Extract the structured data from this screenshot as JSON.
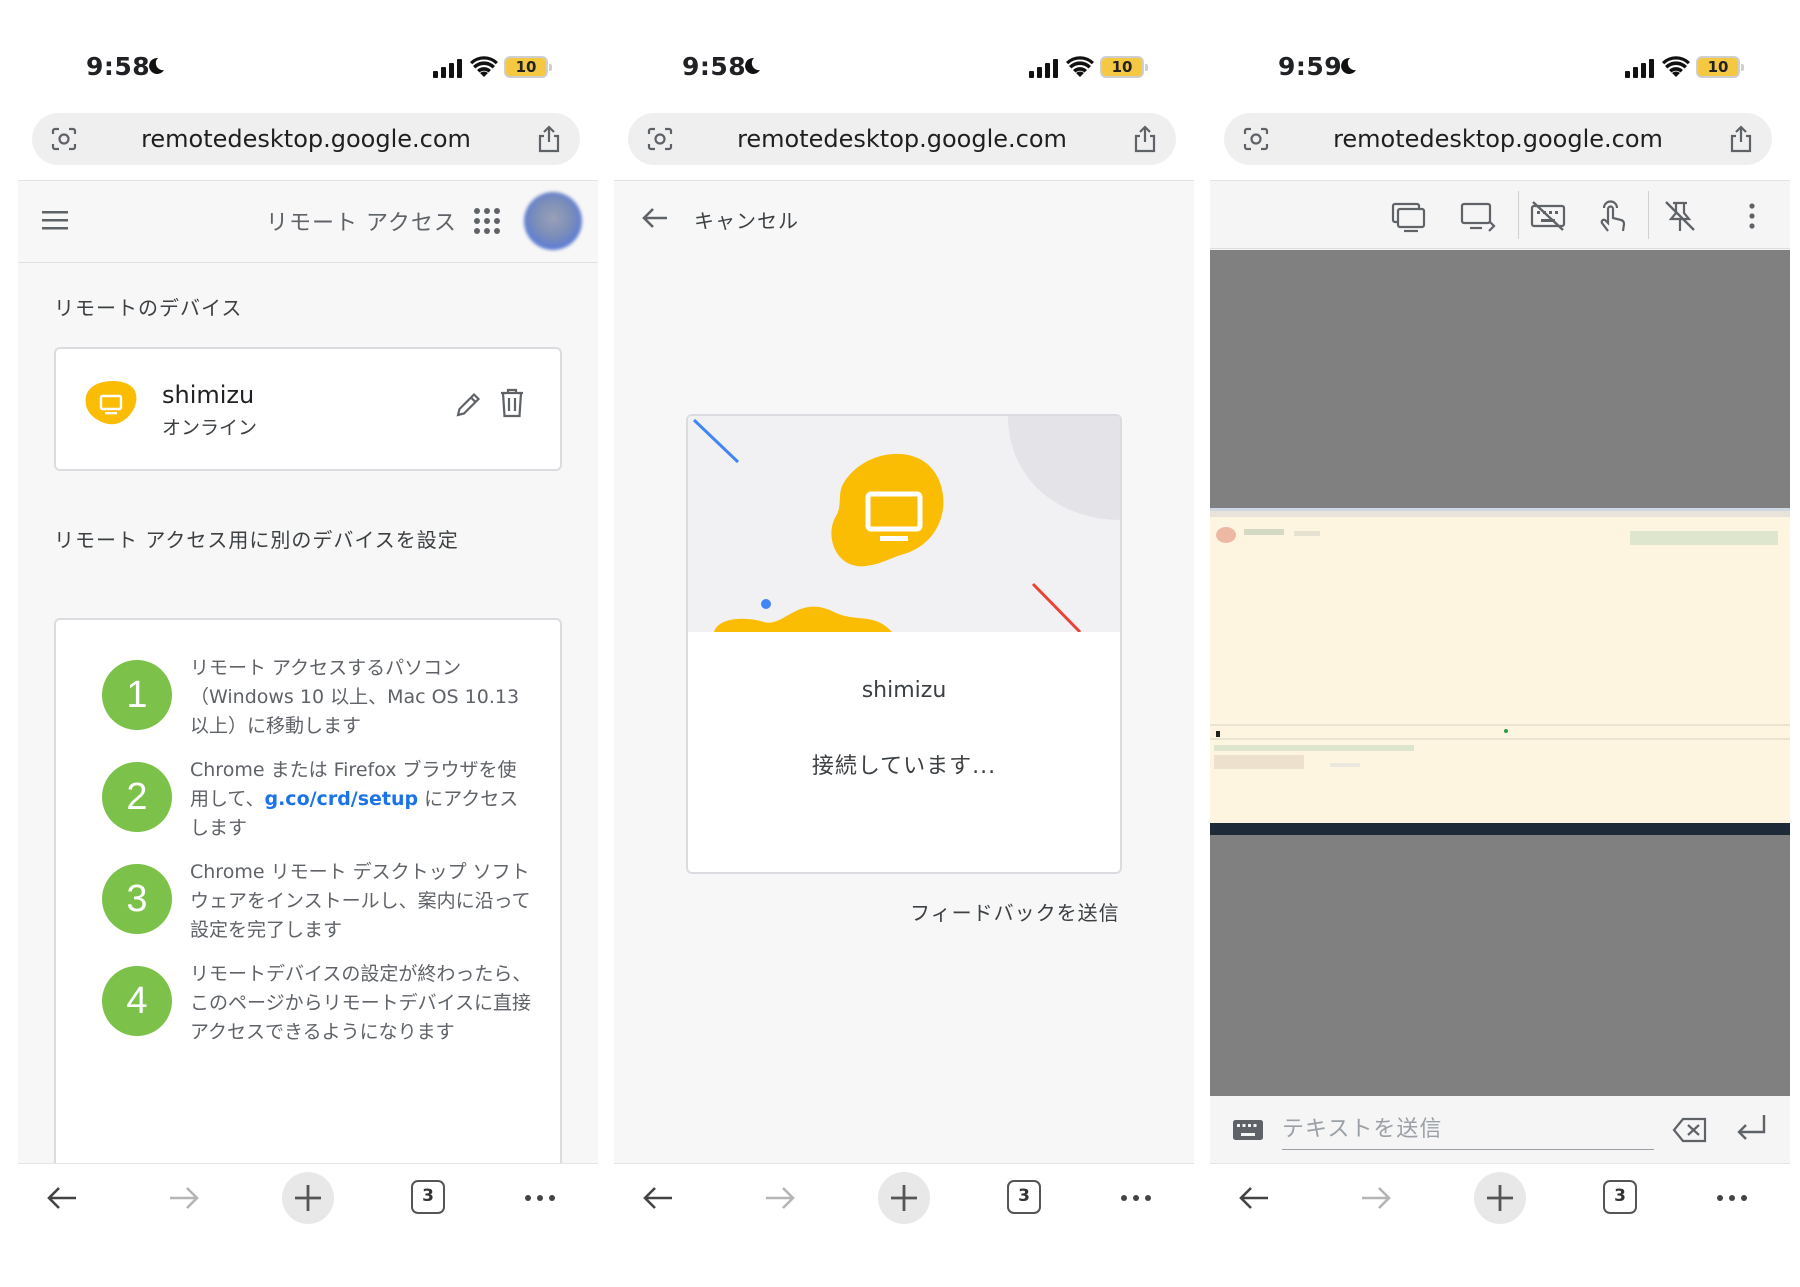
{
  "phones": [
    {
      "status": {
        "time": "9:58",
        "battery": "10"
      },
      "url": "remotedesktop.google.com",
      "tab_count": "3",
      "app_title": "リモート アクセス",
      "remote_devices_title": "リモートのデバイス",
      "device": {
        "name": "shimizu",
        "status": "オンライン"
      },
      "setup_title": "リモート アクセス用に別のデバイスを設定",
      "steps": [
        {
          "num": "1",
          "text": "リモート アクセスするパソコン（Windows 10 以上、Mac OS 10.13 以上）に移動します"
        },
        {
          "num": "2",
          "text_before": "Chrome または Firefox ブラウザを使用して、",
          "link": "g.co/crd/setup",
          "text_after": " にアクセスします"
        },
        {
          "num": "3",
          "text": "Chrome リモート デスクトップ ソフトウェアをインストールし、案内に沿って設定を完了します"
        },
        {
          "num": "4",
          "text": "リモートデバイスの設定が終わったら、このページからリモートデバイスに直接アクセスできるようになります"
        }
      ]
    },
    {
      "status": {
        "time": "9:58",
        "battery": "10"
      },
      "url": "remotedesktop.google.com",
      "tab_count": "3",
      "cancel_label": "キャンセル",
      "device_name": "shimizu",
      "connecting_text": "接続しています...",
      "feedback_label": "フィードバックを送信"
    },
    {
      "status": {
        "time": "9:59",
        "battery": "10"
      },
      "url": "remotedesktop.google.com",
      "tab_count": "3",
      "send_text_placeholder": "テキストを送信"
    }
  ],
  "icons": {
    "status": [
      "moon-icon",
      "signal-icon",
      "wifi-icon",
      "battery-icon"
    ],
    "urlbar": [
      "lens-icon",
      "share-icon"
    ],
    "bottombar": [
      "back-arrow-icon",
      "forward-arrow-icon",
      "plus-icon",
      "tabs-icon",
      "more-dots-icon"
    ],
    "remote_toolbar": [
      "display-icon",
      "display-switch-icon",
      "keyboard-off-icon",
      "touch-icon",
      "unpin-icon",
      "more-vert-icon"
    ]
  },
  "colors": {
    "step_green": "#7cc24a",
    "device_yellow": "#fbbc04",
    "link_blue": "#1a73e8",
    "remote_bg": "#808080"
  }
}
